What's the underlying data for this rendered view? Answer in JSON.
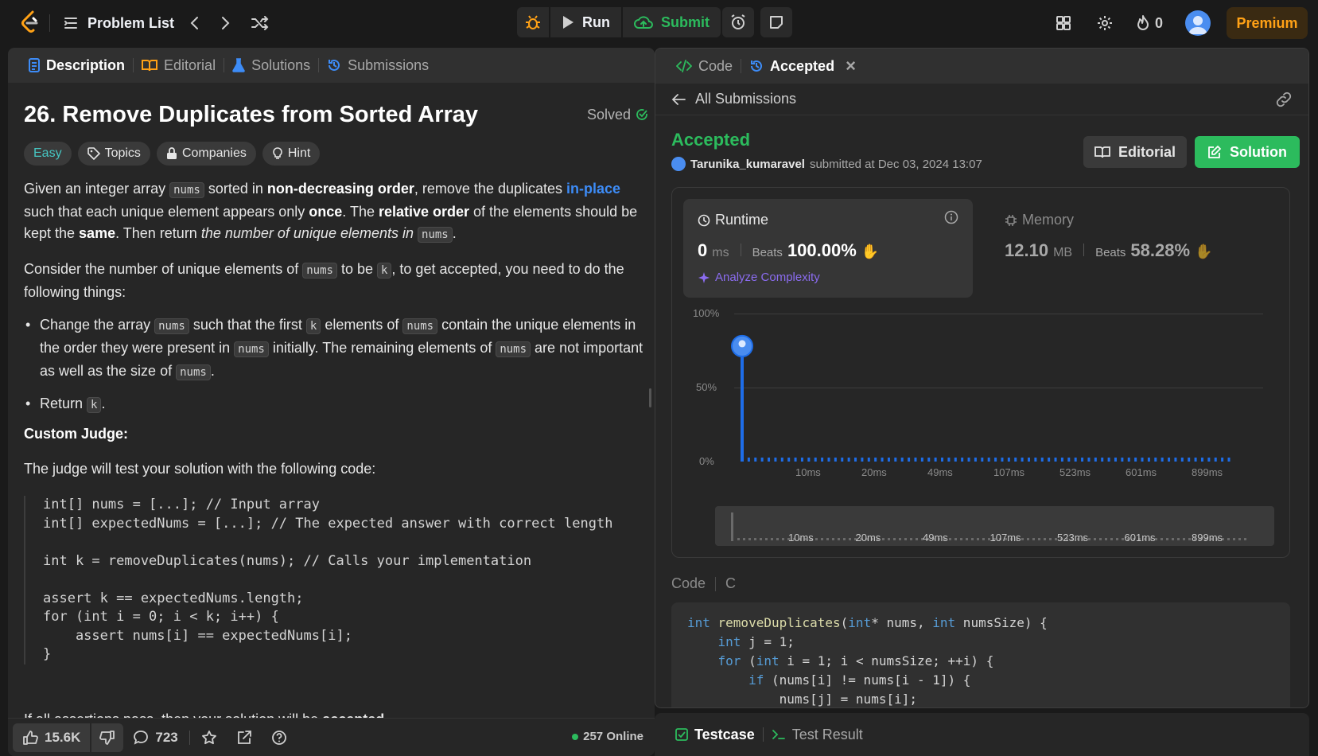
{
  "topbar": {
    "problem_list": "Problem List",
    "run": "Run",
    "submit": "Submit",
    "streak": "0",
    "premium": "Premium"
  },
  "left_tabs": [
    {
      "label": "Description"
    },
    {
      "label": "Editorial"
    },
    {
      "label": "Solutions"
    },
    {
      "label": "Submissions"
    }
  ],
  "problem": {
    "title": "26. Remove Duplicates from Sorted Array",
    "solved": "Solved",
    "difficulty": "Easy",
    "chips": [
      "Topics",
      "Companies",
      "Hint"
    ],
    "p1": {
      "a": "Given an integer array ",
      "code1": "nums",
      "b": " sorted in ",
      "bold1": "non-decreasing order",
      "c": ", remove the duplicates ",
      "link": "in-place",
      "d": " such that each unique element appears only ",
      "bold2": "once",
      "e": ". The ",
      "bold3": "relative order",
      "f": " of the elements should be kept the ",
      "bold4": "same",
      "g": ". Then return ",
      "ital": "the number of unique elements in",
      "code2": "nums",
      "h": "."
    },
    "p2": {
      "a": "Consider the number of unique elements of ",
      "code1": "nums",
      "b": " to be ",
      "code2": "k",
      "c": ", to get accepted, you need to do the following things:"
    },
    "li1": {
      "a": "Change the array ",
      "c1": "nums",
      "b": " such that the first ",
      "c2": "k",
      "c": " elements of ",
      "c3": "nums",
      "d": " contain the unique elements in the order they were present in ",
      "c4": "nums",
      "e": " initially. The remaining elements of ",
      "c5": "nums",
      "f": " are not important as well as the size of ",
      "c6": "nums",
      "g": "."
    },
    "li2": {
      "a": "Return ",
      "c1": "k",
      "b": "."
    },
    "judge_heading": "Custom Judge:",
    "judge_intro": "The judge will test your solution with the following code:",
    "judge_code": "int[] nums = [...]; // Input array\nint[] expectedNums = [...]; // The expected answer with correct length\n\nint k = removeDuplicates(nums); // Calls your implementation\n\nassert k == expectedNums.length;\nfor (int i = 0; i < k; i++) {\n    assert nums[i] == expectedNums[i];\n}",
    "partial": {
      "a": "If all assertions pass, then your solution will be ",
      "b": "accepted"
    }
  },
  "left_bottom": {
    "likes": "15.6K",
    "comments": "723",
    "online": "257 Online"
  },
  "right_tabs": [
    {
      "label": "Code"
    },
    {
      "label": "Accepted"
    }
  ],
  "submission": {
    "back_label": "All Submissions",
    "status": "Accepted",
    "user": "Tarunika_kumaravel",
    "submitted_text": "submitted at Dec 03, 2024 13:07",
    "editorial_btn": "Editorial",
    "solution_btn": "Solution",
    "runtime": {
      "label": "Runtime",
      "value": "0",
      "unit": "ms",
      "beats_label": "Beats",
      "beats": "100.00%",
      "analyze": "Analyze Complexity"
    },
    "memory": {
      "label": "Memory",
      "value": "12.10",
      "unit": "MB",
      "beats_label": "Beats",
      "beats": "58.28%"
    },
    "code_label": "Code",
    "code_lang": "C"
  },
  "chart_data": {
    "type": "bar",
    "y_ticks": [
      "100%",
      "50%",
      "0%"
    ],
    "x_ticks": [
      "10ms",
      "20ms",
      "49ms",
      "107ms",
      "523ms",
      "601ms",
      "899ms"
    ],
    "highlight": {
      "x": "0ms",
      "y": 78
    },
    "ylim": [
      0,
      100
    ],
    "n_bars": 74
  },
  "code_lines": [
    {
      "parts": [
        [
          "kw",
          "int "
        ],
        [
          "fn",
          "removeDuplicates"
        ],
        [
          "",
          "("
        ],
        [
          "kw",
          "int"
        ],
        [
          "",
          "* nums, "
        ],
        [
          "kw",
          "int"
        ],
        [
          "",
          " numsSize) {"
        ]
      ]
    },
    {
      "parts": [
        [
          "",
          "    "
        ],
        [
          "kw",
          "int"
        ],
        [
          "",
          " j = 1;"
        ]
      ]
    },
    {
      "parts": [
        [
          "",
          "    "
        ],
        [
          "kw",
          "for"
        ],
        [
          "",
          " ("
        ],
        [
          "kw",
          "int"
        ],
        [
          "",
          " i = 1; i < numsSize; ++i) {"
        ]
      ]
    },
    {
      "parts": [
        [
          "",
          "        "
        ],
        [
          "kw",
          "if"
        ],
        [
          "",
          " (nums[i] != nums[i - 1]) {"
        ]
      ]
    },
    {
      "parts": [
        [
          "",
          "            nums[j] = nums[i];"
        ]
      ]
    }
  ],
  "bottom_tabs": [
    {
      "label": "Testcase"
    },
    {
      "label": "Test Result"
    }
  ],
  "colors": {
    "accent_green": "#2cbb5d",
    "easy": "#46c6c2",
    "premium": "#ffa116",
    "link": "#3d8cf7",
    "chart_blue": "#1e6de8"
  }
}
